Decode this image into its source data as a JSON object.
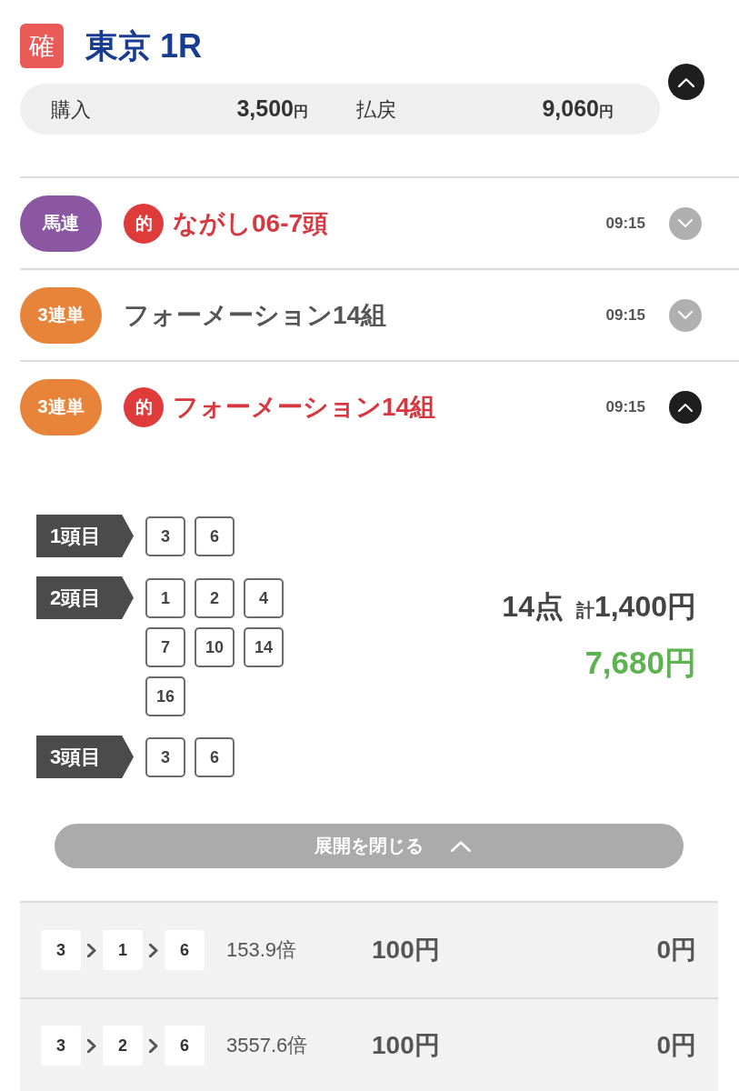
{
  "race": {
    "status_badge": "確",
    "title": "東京 1R",
    "expanded": true
  },
  "summary": [
    {
      "label": "購入",
      "amount": "3,500",
      "unit": "円"
    },
    {
      "label": "払戻",
      "amount": "9,060",
      "unit": "円"
    }
  ],
  "bets": [
    {
      "type": "馬連",
      "color": "#8b57a2",
      "hit": true,
      "hit_mark": "的",
      "title": "ながし06-7頭",
      "time": "09:15",
      "expanded": false
    },
    {
      "type": "3連単",
      "color": "#e8833a",
      "hit": false,
      "title": "フォーメーション14組",
      "time": "09:15",
      "expanded": false
    },
    {
      "type": "3連単",
      "color": "#e8833a",
      "hit": true,
      "hit_mark": "的",
      "title": "フォーメーション14組",
      "time": "09:15",
      "expanded": true,
      "detail": {
        "positions": [
          {
            "label": "1頭目",
            "numbers": [
              "3",
              "6"
            ]
          },
          {
            "label": "2頭目",
            "numbers": [
              "1",
              "2",
              "4",
              "7",
              "10",
              "14",
              "16"
            ]
          },
          {
            "label": "3頭目",
            "numbers": [
              "3",
              "6"
            ]
          }
        ],
        "points": "14点",
        "total_label": "計",
        "total": "1,400円",
        "payout": "7,680円",
        "close_label": "展開を閉じる",
        "results": [
          {
            "combo": [
              "3",
              "1",
              "6"
            ],
            "odds": "153.9倍",
            "stake": "100円",
            "payout": "0円"
          },
          {
            "combo": [
              "3",
              "2",
              "6"
            ],
            "odds": "3557.6倍",
            "stake": "100円",
            "payout": "0円"
          }
        ]
      }
    }
  ]
}
